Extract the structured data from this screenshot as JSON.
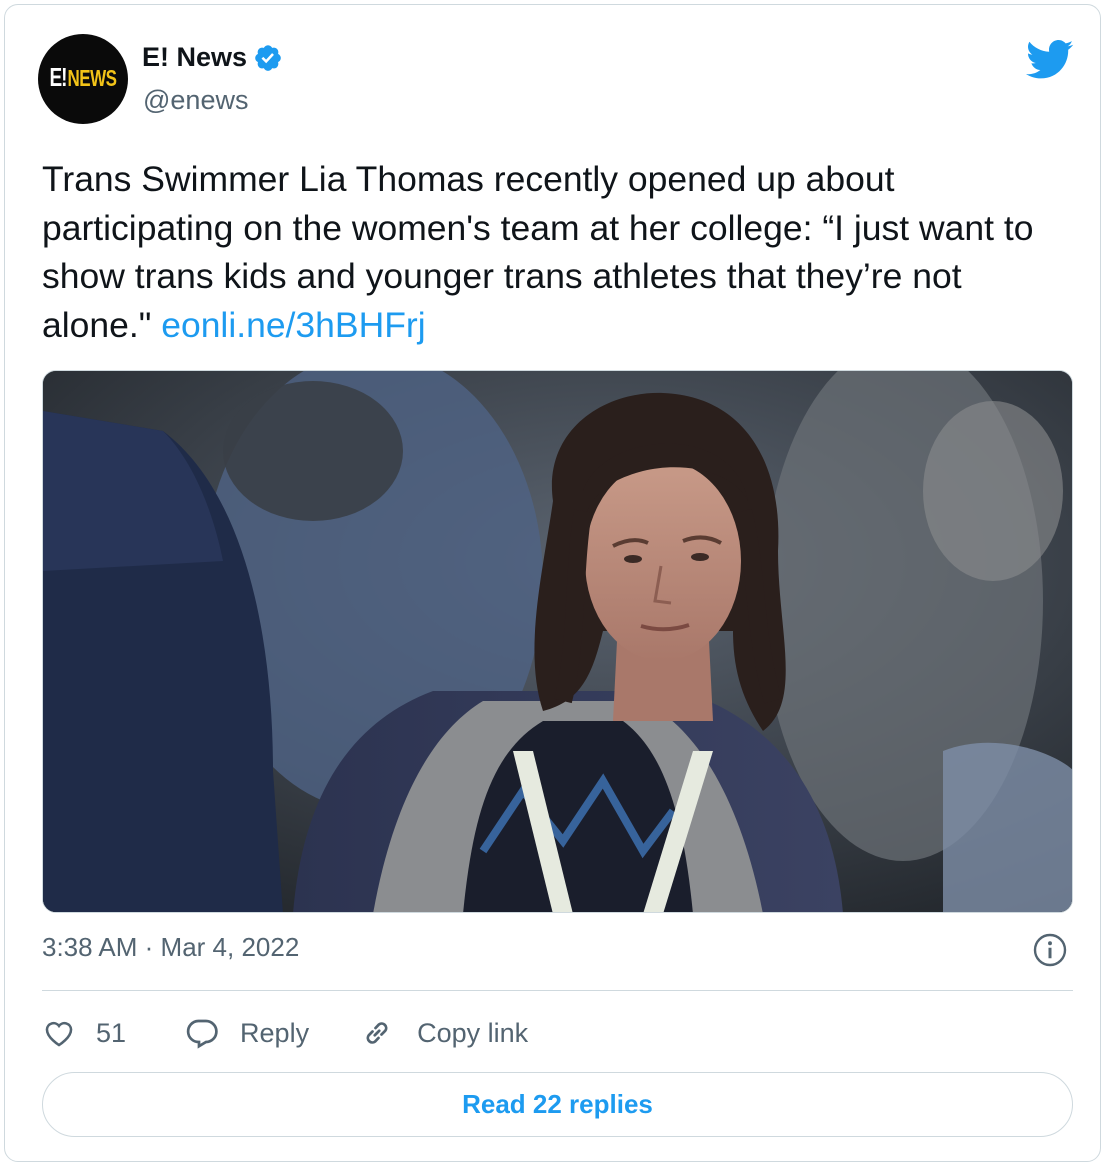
{
  "account": {
    "display_name": "E! News",
    "handle": "@enews",
    "verified": true,
    "avatar_logo": {
      "mark": "E!",
      "word": "NEWS"
    }
  },
  "tweet": {
    "text_before_link": "Trans Swimmer Lia Thomas recently opened up about participating on the women's team at her college: “I just want to show trans kids and younger trans athletes that they’re not alone.\"",
    "link": "eonli.ne/3hBHFrj",
    "timestamp_time": "3:38 AM",
    "separator": "·",
    "timestamp_date": "Mar 4, 2022"
  },
  "actions": {
    "like_count": "51",
    "reply_label": "Reply",
    "copy_link_label": "Copy link"
  },
  "footer": {
    "read_replies_label": "Read 22 replies"
  },
  "icons": {
    "logo": "twitter-bird-icon",
    "verified": "verified-badge-icon",
    "info": "info-icon",
    "like": "heart-icon",
    "reply": "reply-bubble-icon",
    "copy": "link-icon"
  },
  "colors": {
    "accent": "#1d9bf0",
    "text_primary": "#0f1419",
    "text_secondary": "#536471",
    "border": "#cfd9de",
    "logo_yellow": "#f2c318"
  }
}
